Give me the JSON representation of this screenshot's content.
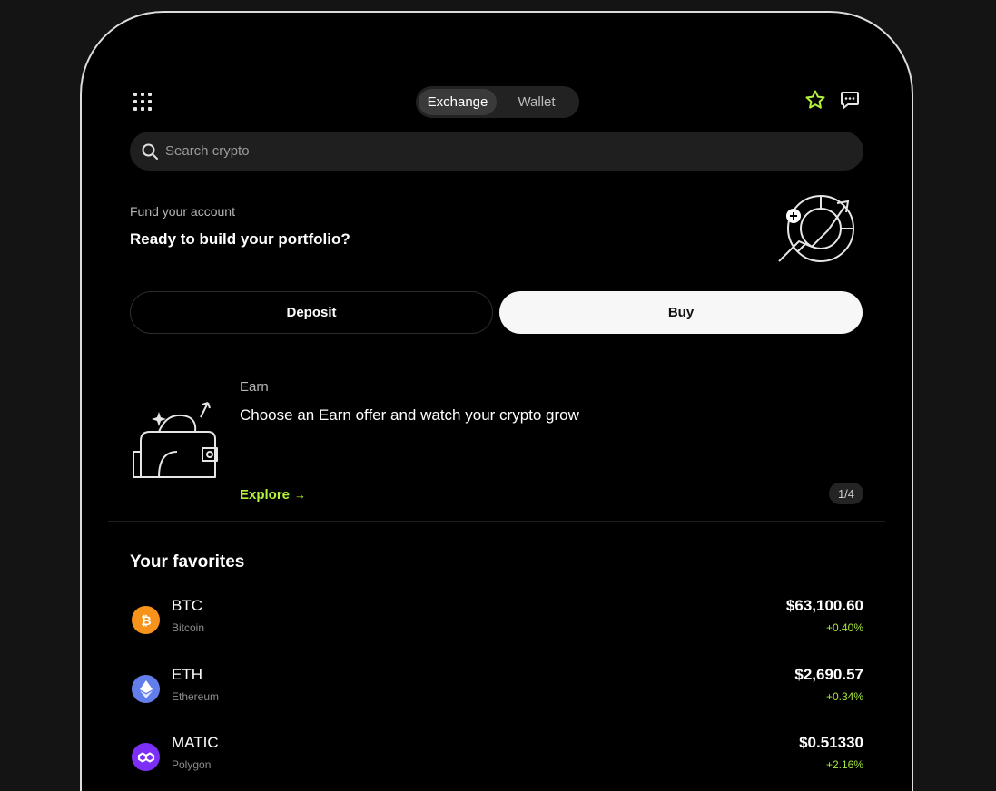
{
  "header": {
    "menu_icon": "grid-menu-icon",
    "tabs": [
      {
        "label": "Exchange",
        "active": true
      },
      {
        "label": "Wallet",
        "active": false
      }
    ],
    "favorites_icon": "star-icon",
    "chat_icon": "chat-icon"
  },
  "search": {
    "placeholder": "Search crypto",
    "icon": "search-icon"
  },
  "fund": {
    "subtitle": "Fund your account",
    "title": "Ready to build your portfolio?",
    "illustration": "portfolio-chart-icon",
    "deposit_label": "Deposit",
    "buy_label": "Buy"
  },
  "earn": {
    "subtitle": "Earn",
    "title": "Choose an Earn offer and watch your crypto grow",
    "illustration": "wallet-growth-icon",
    "explore_label": "Explore",
    "explore_arrow": "→",
    "pager": "1/4"
  },
  "favorites": {
    "title": "Your favorites",
    "items": [
      {
        "symbol": "BTC",
        "name": "Bitcoin",
        "price": "$63,100.60",
        "change": "+0.40%",
        "icon": "bitcoin-icon",
        "color": "#f7931a"
      },
      {
        "symbol": "ETH",
        "name": "Ethereum",
        "price": "$2,690.57",
        "change": "+0.34%",
        "icon": "ethereum-icon",
        "color": "#627eea"
      },
      {
        "symbol": "MATIC",
        "name": "Polygon",
        "price": "$0.51330",
        "change": "+2.16%",
        "icon": "polygon-icon",
        "color": "#7b2ff7"
      }
    ]
  },
  "colors": {
    "accent": "#b5f23d",
    "positive": "#a8e63c",
    "background": "#000000"
  }
}
